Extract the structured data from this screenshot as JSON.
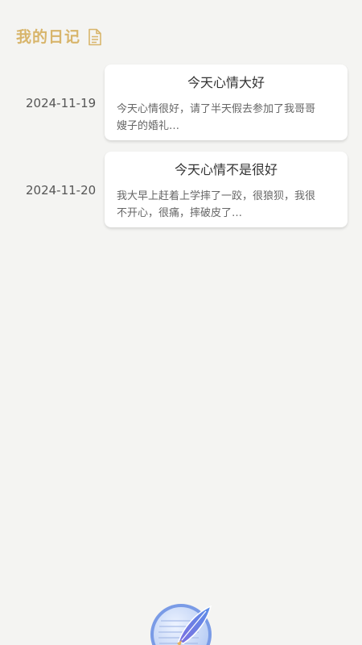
{
  "header": {
    "title": "我的日记",
    "title_color": "#d8b56b",
    "icon": "document-icon"
  },
  "entries": [
    {
      "date": "2024-11-19",
      "title": "今天心情大好",
      "excerpt_line1": "今天心情很好，请了半天假去参加了我哥哥",
      "excerpt_line2": "嫂子的婚礼…"
    },
    {
      "date": "2024-11-20",
      "title": "今天心情不是很好",
      "excerpt_line1": "我大早上赶着上学摔了一跤，很狼狈，我很",
      "excerpt_line2": "不开心，很痛，摔破皮了…"
    }
  ],
  "fab": {
    "icon": "quill-notebook-icon"
  },
  "colors": {
    "background": "#f4f4f2",
    "card": "#ffffff",
    "accent": "#d8b56b"
  }
}
